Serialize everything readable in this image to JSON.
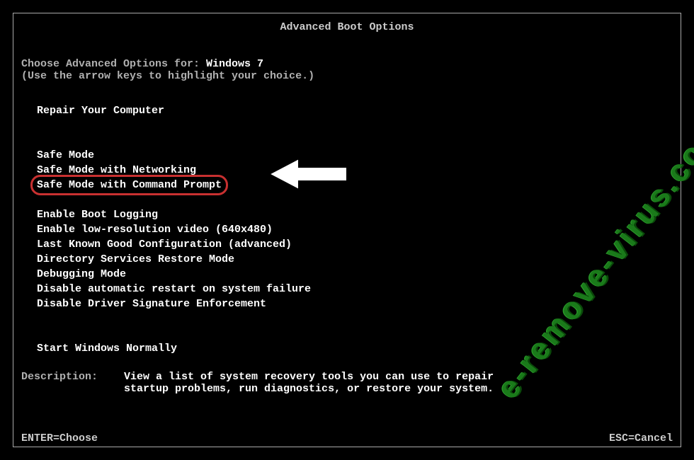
{
  "title": "Advanced Boot Options",
  "intro": {
    "prefix": "Choose Advanced Options for: ",
    "os": "Windows 7",
    "hint": "(Use the arrow keys to highlight your choice.)"
  },
  "menu": {
    "repair": "Repair Your Computer",
    "safe_mode": "Safe Mode",
    "safe_mode_net": "Safe Mode with Networking",
    "safe_mode_cmd": "Safe Mode with Command Prompt",
    "boot_log": "Enable Boot Logging",
    "low_res": "Enable low-resolution video (640x480)",
    "lkgc": "Last Known Good Configuration (advanced)",
    "dsrm": "Directory Services Restore Mode",
    "debug": "Debugging Mode",
    "no_auto_restart": "Disable automatic restart on system failure",
    "no_driver_sig": "Disable Driver Signature Enforcement",
    "start_normal": "Start Windows Normally"
  },
  "description": {
    "label": "Description:",
    "text": "View a list of system recovery tools you can use to repair startup problems, run diagnostics, or restore your system."
  },
  "footer": {
    "enter": "ENTER=Choose",
    "esc": "ESC=Cancel"
  },
  "watermark": "e-remove-virus.com"
}
